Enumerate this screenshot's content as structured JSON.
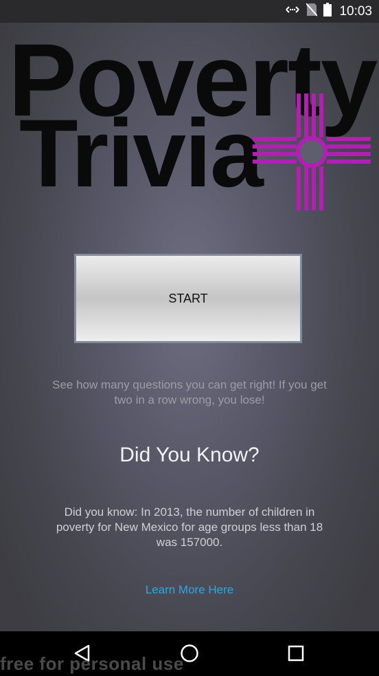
{
  "status_bar": {
    "time": "10:03",
    "icons": [
      "data-sync-icon",
      "no-sim-icon",
      "battery-icon"
    ]
  },
  "logo": {
    "line1": "Poverty",
    "line2": "Trivia",
    "emblem": "zia-sun-symbol",
    "emblem_color": "#b21fb3"
  },
  "main": {
    "start_label": "START",
    "hint": "See how many questions you can get right! If you get two in a row wrong, you lose!",
    "dyk_title": "Did You Know?",
    "fact": "Did you know: In 2013, the number of children in poverty for New Mexico for age groups less than 18 was 157000.",
    "learn_more": "Learn More Here",
    "link_color": "#29a9e6"
  },
  "nav_bar": {
    "icons": [
      "back-icon",
      "home-icon",
      "recents-icon"
    ]
  },
  "watermark": "free for personal use"
}
